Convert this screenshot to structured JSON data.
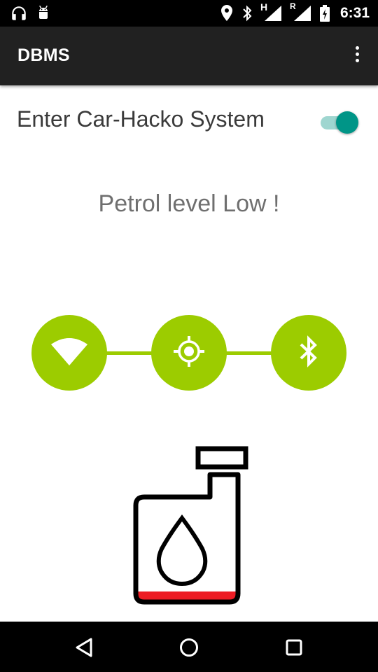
{
  "status_bar": {
    "time": "6:31",
    "network_type": "H",
    "roaming_indicator": "R",
    "icons": [
      "headphones-icon",
      "android-icon",
      "location-icon",
      "bluetooth-icon",
      "signal-icon",
      "battery-charging-icon"
    ]
  },
  "app_bar": {
    "title": "DBMS",
    "overflow_icon": "more-vert-icon"
  },
  "switch_row": {
    "label": "Enter Car-Hacko System",
    "checked": true
  },
  "message": "Petrol level Low !",
  "connection_icons": [
    "wifi-icon",
    "gps-icon",
    "bluetooth-icon"
  ],
  "fuel": {
    "level_fraction": 0.1,
    "fill_color": "#ed1c24"
  },
  "colors": {
    "accent": "#009587",
    "connection_green": "#9ccc00",
    "app_bar": "#212121"
  },
  "nav_bar": {
    "icons": [
      "back-icon",
      "home-icon",
      "recents-icon"
    ]
  }
}
